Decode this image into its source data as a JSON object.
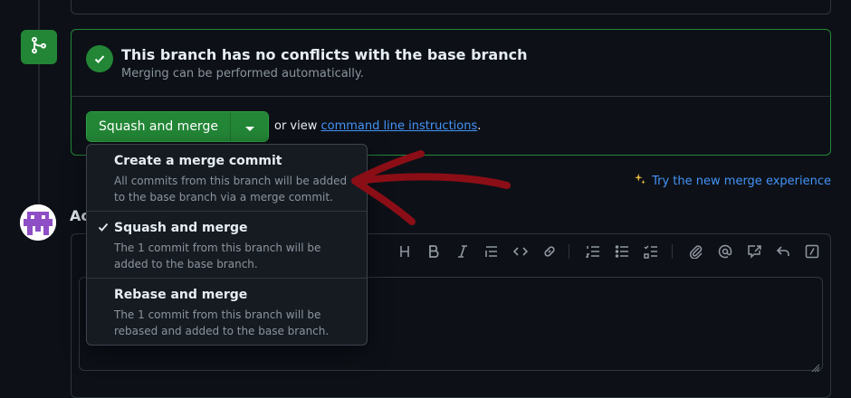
{
  "merge_status": {
    "title": "This branch has no conflicts with the base branch",
    "subtitle": "Merging can be performed automatically."
  },
  "merge_button": {
    "label": "Squash and merge"
  },
  "command_line": {
    "prefix": "or view ",
    "link": "command line instructions",
    "suffix": "."
  },
  "try_new": {
    "label": "Try the new merge experience"
  },
  "comment": {
    "heading": "Ac"
  },
  "merge_options": [
    {
      "title": "Create a merge commit",
      "description": "All commits from this branch will be added to the base branch via a merge commit.",
      "selected": false
    },
    {
      "title": "Squash and merge",
      "description": "The 1 commit from this branch will be added to the base branch.",
      "selected": true
    },
    {
      "title": "Rebase and merge",
      "description": "The 1 commit from this branch will be rebased and added to the base branch.",
      "selected": false
    }
  ],
  "toolbar_icons": [
    "heading-icon",
    "bold-icon",
    "italic-icon",
    "quote-icon",
    "code-icon",
    "link-icon",
    "ordered-list-icon",
    "unordered-list-icon",
    "task-list-icon",
    "attach-icon",
    "mention-icon",
    "reference-icon",
    "undo-icon",
    "slash-command-icon"
  ],
  "colors": {
    "background": "#0d1117",
    "accent_green": "#238636",
    "link_blue": "#4493f8",
    "muted_text": "#8b949e",
    "annotation_red": "#8b0e16"
  }
}
